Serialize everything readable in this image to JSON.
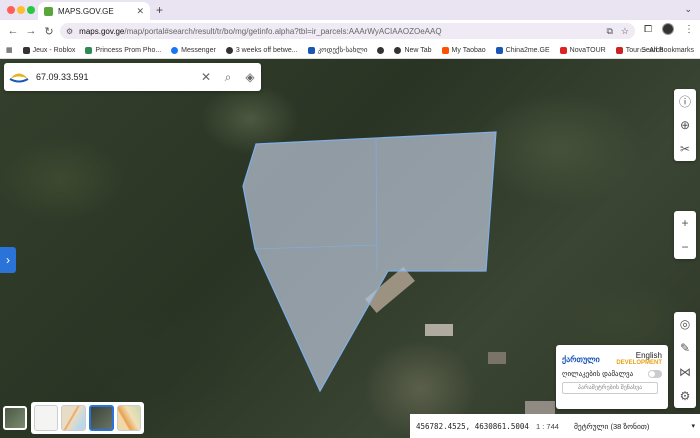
{
  "browser": {
    "traffic_colors": [
      "#ff5f57",
      "#febc2e",
      "#28c840"
    ],
    "tab_title": "MAPS.GOV.GE",
    "url_host": "maps.gov.ge",
    "url_path": "/map/portal#search/result/tr/bo/mg/getinfo.alpha?tbl=ir_parcels:AAArWyACIAAOZOeAAQ"
  },
  "bookmarks": [
    {
      "label": "Jeux - Roblox",
      "icon": "roblox-icon",
      "color": "#333"
    },
    {
      "label": "Princess Prom Pho...",
      "icon": "game-icon",
      "color": "#2e8b57"
    },
    {
      "label": "Messenger",
      "icon": "messenger-icon",
      "color": "#1877f2"
    },
    {
      "label": "3 weeks off betwe...",
      "icon": "globe-icon",
      "color": "#333"
    },
    {
      "label": "კოდექს-სახლი",
      "icon": "bird-icon",
      "color": "#1a56b8"
    },
    {
      "label": "",
      "icon": "globe-icon",
      "color": "#333"
    },
    {
      "label": "New Tab",
      "icon": "globe-icon",
      "color": "#333"
    },
    {
      "label": "My Taobao",
      "icon": "taobao-icon",
      "color": "#ff5000"
    },
    {
      "label": "China2me.GE",
      "icon": "china2me-icon",
      "color": "#1a56b8"
    },
    {
      "label": "NovaTOUR",
      "icon": "nova-icon",
      "color": "#d22"
    },
    {
      "label": "Tour Search",
      "icon": "plane-icon",
      "color": "#c22"
    }
  ],
  "bookmarks_all": "All Bookmarks",
  "search": {
    "query": "67.09.33.591"
  },
  "lang_panel": {
    "georgian": "ქართული",
    "english": "English",
    "development": "DEVELOPMENT",
    "toggle_label": "ღილაკების დამალვა",
    "button": "პარამეტრების შენახვა"
  },
  "status": {
    "coordinates": "456782.4525, 4630861.5004",
    "scale": "1 : 744",
    "projection": "მეტრული (38 ზონით)"
  },
  "colors": {
    "parcel_fill": "#b9c3d6",
    "parcel_stroke": "#7fb0e8",
    "accent": "#2a73d9"
  }
}
